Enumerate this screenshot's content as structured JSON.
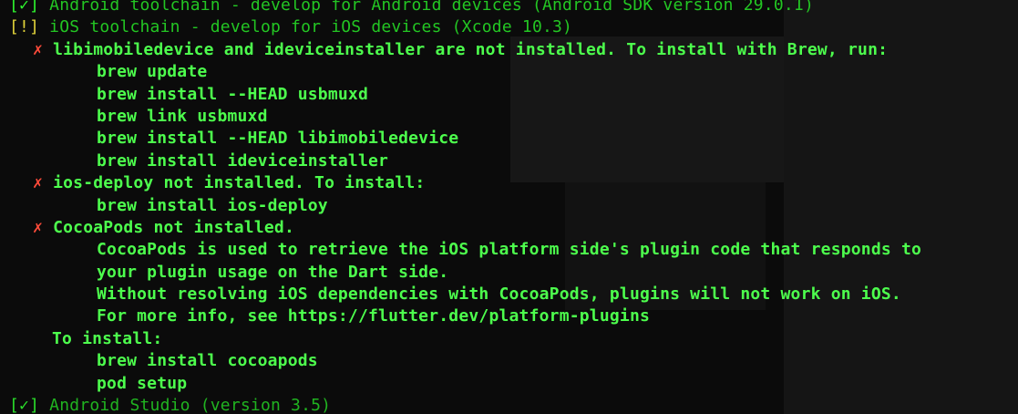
{
  "terminal": {
    "lines": {
      "android": {
        "mark": "[✓]",
        "text": "Android toolchain - develop for Android devices (Android SDK version 29.0.1)"
      },
      "ios": {
        "mark": "[!]",
        "text": "iOS toolchain - develop for iOS devices (Xcode 10.3)"
      },
      "libimobile": {
        "mark": "✗",
        "text": "libimobiledevice and ideviceinstaller are not installed. To install with Brew, run:"
      },
      "brew_update": "brew update",
      "brew_usbmuxd": "brew install --HEAD usbmuxd",
      "brew_link": "brew link usbmuxd",
      "brew_libimobile": "brew install --HEAD libimobiledevice",
      "brew_ideviceinstaller": "brew install ideviceinstaller",
      "iosdeploy": {
        "mark": "✗",
        "text": "ios-deploy not installed. To install:"
      },
      "brew_iosdeploy": "brew install ios-deploy",
      "cocoapods": {
        "mark": "✗",
        "text": "CocoaPods not installed."
      },
      "cocoa_desc1": "CocoaPods is used to retrieve the iOS platform side's plugin code that responds to",
      "cocoa_desc2": "your plugin usage on the Dart side.",
      "cocoa_desc3": "Without resolving iOS dependencies with CocoaPods, plugins will not work on iOS.",
      "cocoa_desc4": "For more info, see https://flutter.dev/platform-plugins",
      "to_install": "To install:",
      "brew_cocoapods": "brew install cocoapods",
      "pod_setup": "pod setup",
      "android_studio": {
        "mark": "[✓]",
        "text": "Android Studio (version 3.5)"
      }
    }
  },
  "colors": {
    "background": "#0b0b0b",
    "text_green": "#2ef52e",
    "warning_yellow": "#e0d23a",
    "error_red": "#ff4b3a"
  }
}
